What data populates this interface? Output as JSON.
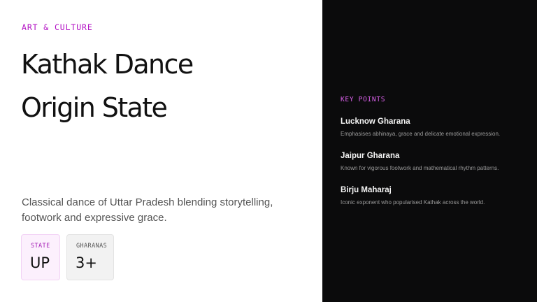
{
  "eyebrow": "ART & CULTURE",
  "title": {
    "line1": "Kathak Dance",
    "line2": "Origin State"
  },
  "description": "Classical dance of Uttar Pradesh blending storytelling, footwork and expressive grace.",
  "stats": [
    {
      "label": "STATE",
      "value": "UP"
    },
    {
      "label": "GHARANAS",
      "value": "3+"
    }
  ],
  "key_points": {
    "heading": "KEY POINTS",
    "items": [
      {
        "title": "Lucknow Gharana",
        "desc": "Emphasises abhinaya, grace and delicate emotional expression."
      },
      {
        "title": "Jaipur Gharana",
        "desc": "Known for vigorous footwork and mathematical rhythm patterns."
      },
      {
        "title": "Birju Maharaj",
        "desc": "Iconic exponent who popularised Kathak across the world."
      }
    ]
  },
  "colors": {
    "accent": "#b312c4",
    "accent_light": "#df63f0",
    "dark_panel": "#0b0b0c"
  }
}
